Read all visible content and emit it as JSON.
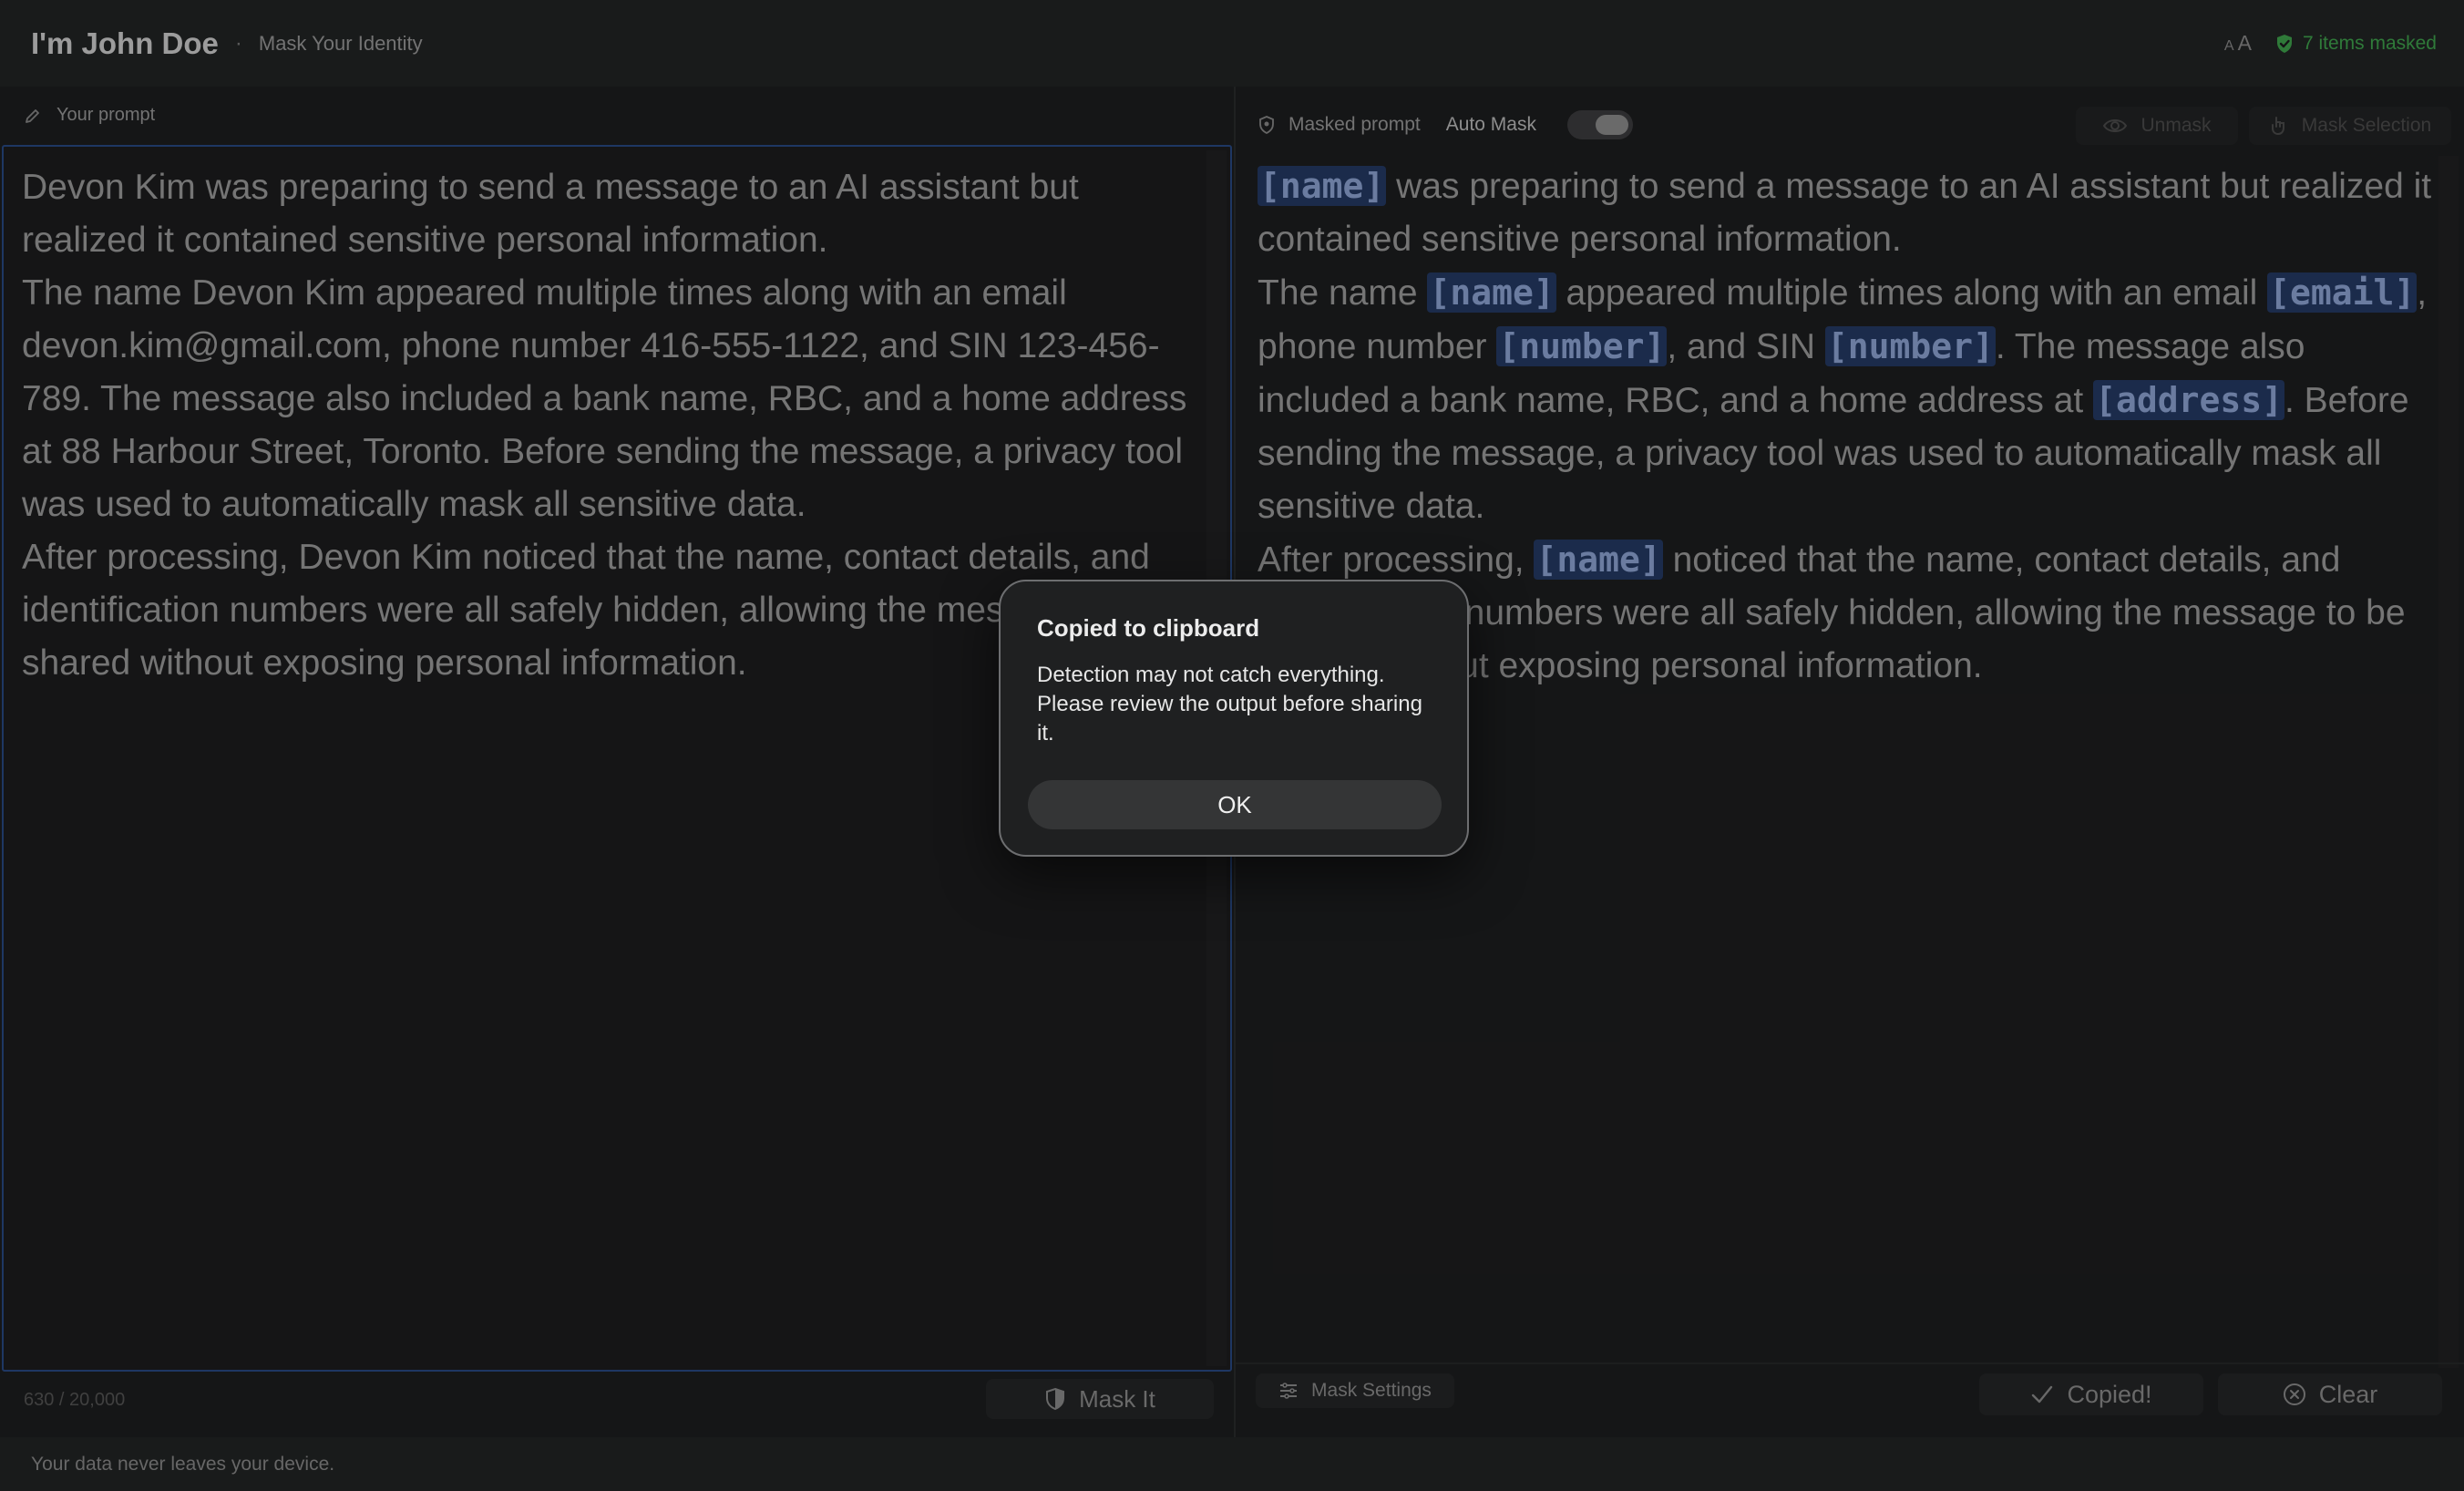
{
  "header": {
    "title": "I'm John Doe",
    "separator": "·",
    "subtitle": "Mask Your Identity",
    "font_small": "A",
    "font_large": "A",
    "masked_status": "7 items masked",
    "status_color": "#3fa34d"
  },
  "left": {
    "label": "Your prompt",
    "paragraphs": [
      "Devon Kim was preparing to send a message to an AI assistant but realized it contained sensitive personal information.",
      "The name Devon Kim appeared multiple times along with an email devon.kim@gmail.com, phone number 416-555-1122, and SIN 123-456-789. The message also included a bank name, RBC, and a home address at 88 Harbour Street, Toronto. Before sending the message, a privacy tool was used to automatically mask all sensitive data.",
      "After processing, Devon Kim noticed that the name, contact details, and identification numbers were all safely hidden, allowing the message to be shared without exposing personal information."
    ],
    "char_count": "630 / 20,000",
    "mask_button": "Mask It"
  },
  "right": {
    "label": "Masked prompt",
    "auto_mask_label": "Auto Mask",
    "unmask_button": "Unmask",
    "mask_selection_button": "Mask Selection",
    "output": {
      "p1": [
        "was preparing to send a message to an AI assistant but realized it contained sensitive personal information."
      ],
      "tags": {
        "name": "[name]",
        "email": "[email]",
        "number": "[number]",
        "address": "[address]"
      },
      "p2_a": "The name ",
      "p2_b": " appeared multiple times along with an email ",
      "p2_c": ", phone number ",
      "p2_d": ", and SIN ",
      "p2_e": ". The message also included a bank name, RBC, and a home address at ",
      "p2_f": ". Before sending the message, a privacy tool was used to automatically mask all sensitive data.",
      "p3_a": "After processing, ",
      "p3_b": " noticed that the name, contact details, and identification numbers were all safely hidden, allowing the message to be shared without exposing personal information."
    },
    "mask_settings_button": "Mask Settings",
    "copied_button": "Copied!",
    "clear_button": "Clear"
  },
  "footer": {
    "privacy_note": "Your data never leaves your device."
  },
  "dialog": {
    "title": "Copied to clipboard",
    "body": "Detection may not catch everything. Please review the output before sharing it.",
    "ok": "OK"
  }
}
